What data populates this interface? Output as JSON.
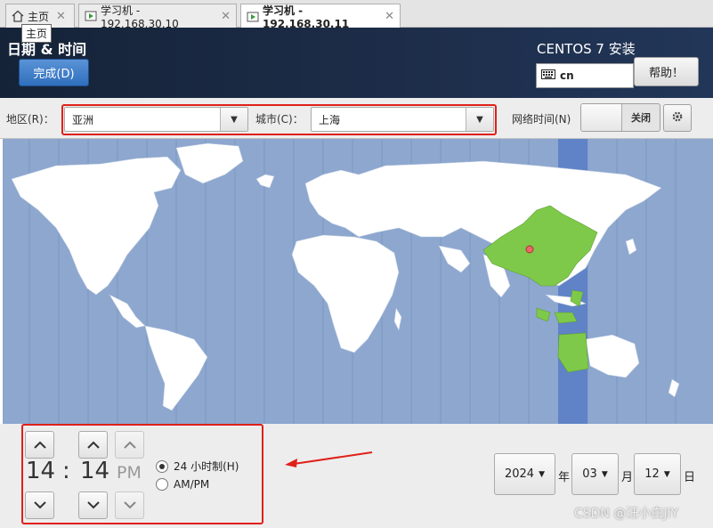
{
  "browser": {
    "tabs": [
      {
        "label": "主页"
      },
      {
        "label": "学习机 - 192.168.30.10"
      },
      {
        "label": "学习机 - 192.168.30.11"
      }
    ],
    "tooltip": "主页"
  },
  "header": {
    "title": "日期 & 时间",
    "done_label": "完成(D)",
    "product": "CENTOS 7 安装",
    "keyboard_layout": "cn",
    "help_label": "帮助！"
  },
  "region": {
    "region_label": "地区(R)：",
    "region_value": "亚洲",
    "city_label": "城市(C)：",
    "city_value": "上海",
    "ntp_label": "网络时间(N)",
    "ntp_state": "关闭"
  },
  "time": {
    "hours": "14",
    "separator": ":",
    "minutes": "14",
    "ampm": "PM",
    "format_24h_label": "24 小时制(H)",
    "format_ampm_label": "AM/PM",
    "selected_format": "24h"
  },
  "date": {
    "year": "2024",
    "year_unit": "年",
    "month": "03",
    "month_unit": "月",
    "day": "12",
    "day_unit": "日"
  },
  "watermark": "CSDN @汪小白JIY",
  "colors": {
    "accent": "#2f6fbd",
    "highlight_red": "#e0201a",
    "ocean": "#8da7cf",
    "land": "#ffffff",
    "selected_zone": "#7fc94a",
    "timezone_band": "#5f83c6"
  }
}
